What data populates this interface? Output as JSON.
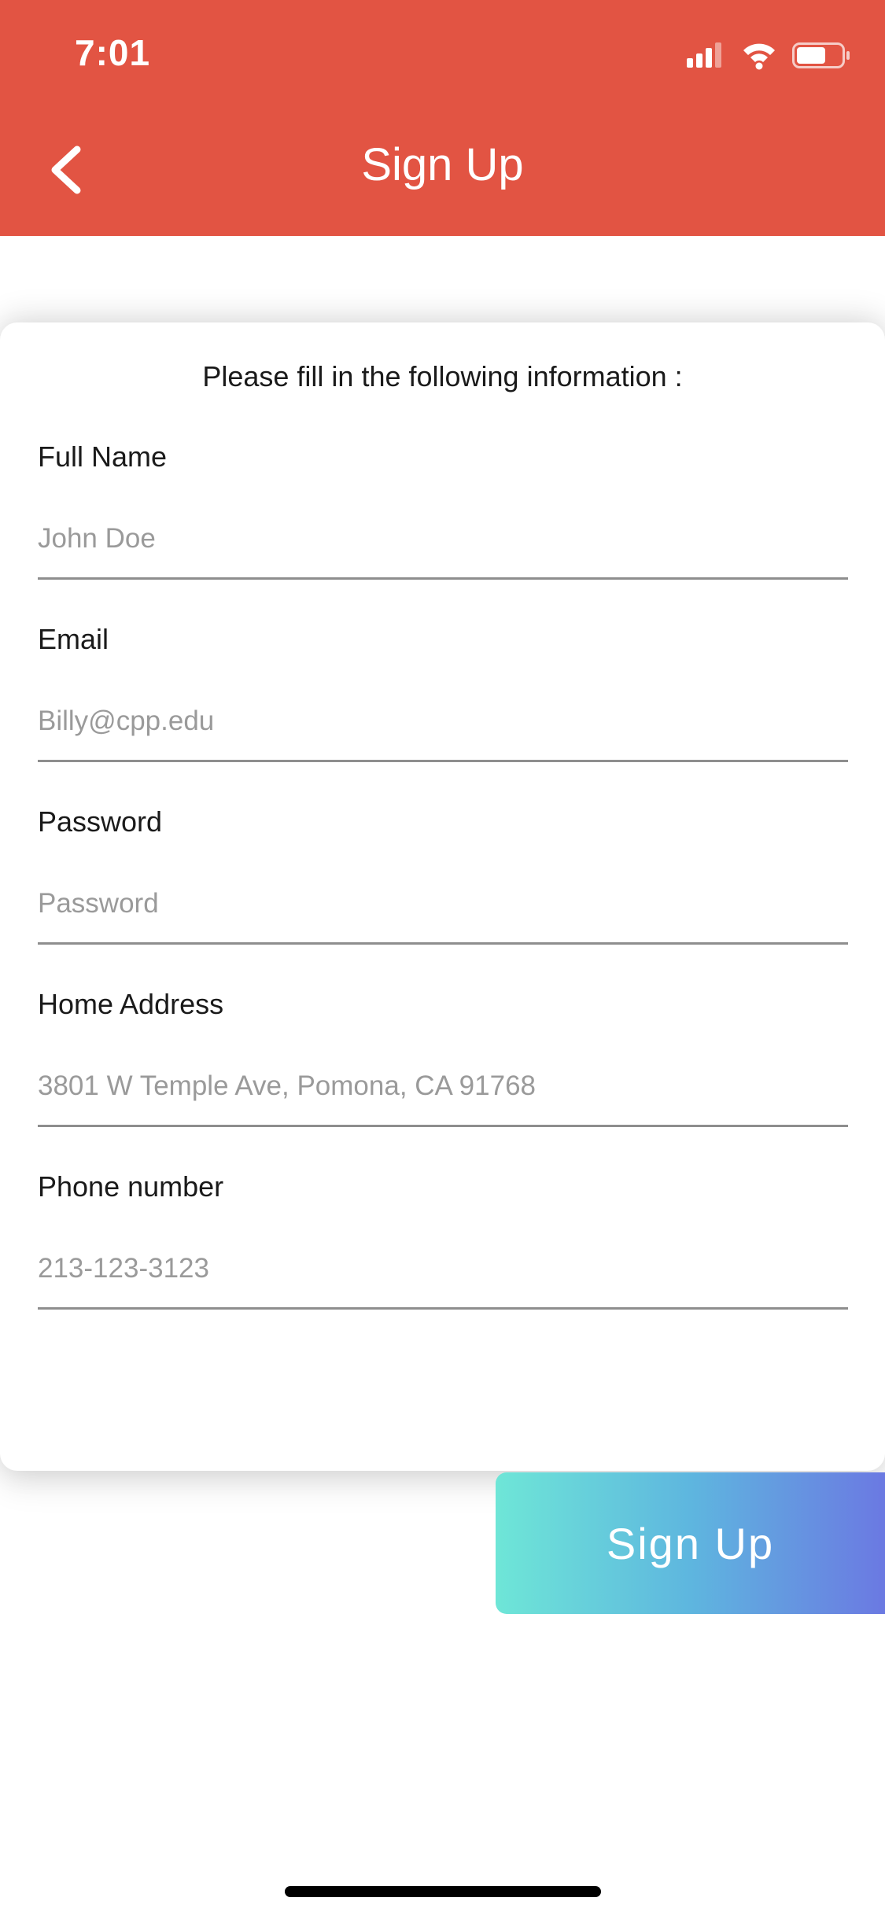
{
  "status_bar": {
    "time": "7:01",
    "icons": [
      "cellular-signal-icon",
      "wifi-icon",
      "battery-icon"
    ]
  },
  "header": {
    "title": "Sign Up",
    "back_icon": "chevron-left-icon",
    "background_color": "#E25443"
  },
  "form": {
    "intro": "Please fill in the following information :",
    "fields": [
      {
        "label": "Full Name",
        "placeholder": "John Doe",
        "value": ""
      },
      {
        "label": "Email",
        "placeholder": "Billy@cpp.edu",
        "value": ""
      },
      {
        "label": "Password",
        "placeholder": "Password",
        "value": ""
      },
      {
        "label": "Home Address",
        "placeholder": "3801 W Temple Ave, Pomona, CA 91768",
        "value": ""
      },
      {
        "label": "Phone number",
        "placeholder": "213-123-3123",
        "value": ""
      }
    ]
  },
  "signup_button": {
    "label": "Sign Up",
    "gradient": [
      "#6EE6D7",
      "#5EB6DF",
      "#6B79E2"
    ]
  }
}
